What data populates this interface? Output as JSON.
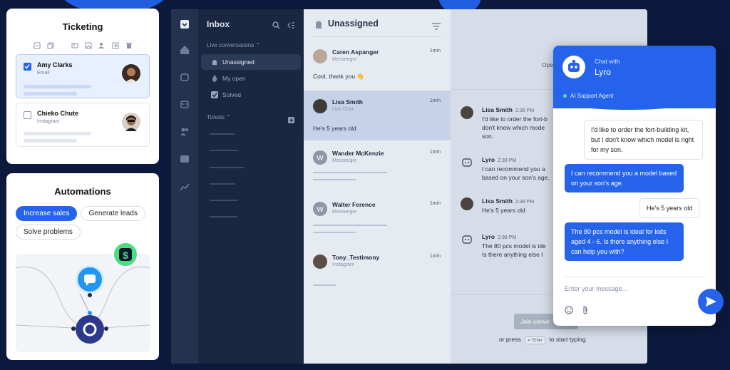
{
  "colors": {
    "background": "#0b1a3c",
    "accent": "#2563eb",
    "sidebar": "#1a2740"
  },
  "ticketing": {
    "title": "Ticketing",
    "toolbar_icons": [
      "collapse-icon",
      "copy-icon",
      "image-icon",
      "image-alt-icon",
      "assign-user-icon",
      "export-icon",
      "trash-icon"
    ],
    "tickets": [
      {
        "name": "Amy Clarks",
        "source": "Email",
        "checked": true
      },
      {
        "name": "Chieko Chute",
        "source": "Instagram",
        "checked": false
      }
    ]
  },
  "automations": {
    "title": "Automations",
    "pills": [
      "Increase sales",
      "Generate leads",
      "Solve problems"
    ],
    "active_pill": "Increase sales",
    "badge_icon": "dollar-icon"
  },
  "inbox": {
    "title": "Inbox",
    "live_label": "Live conversations",
    "items": [
      {
        "label": "Unassigned",
        "icon": "hand-wave-icon",
        "active": true
      },
      {
        "label": "My open",
        "icon": "fire-icon",
        "active": false
      },
      {
        "label": "Solved",
        "icon": "check-icon",
        "active": false
      }
    ],
    "tickets_label": "Tickets"
  },
  "conversations": {
    "title": "Unassigned",
    "list": [
      {
        "name": "Caren Aspanger",
        "source": "Messenger",
        "time": "1min",
        "message": "Cool, thank you 👋"
      },
      {
        "name": "Lisa Smith",
        "source": "Live Chat",
        "time": "1min",
        "message": "He's 5 years old",
        "active": true
      },
      {
        "name": "Wander McKenzie",
        "source": "Messenger",
        "time": "1min",
        "message": ""
      },
      {
        "name": "Walter Ference",
        "source": "Messenger",
        "time": "1min",
        "message": ""
      },
      {
        "name": "Tony_Testimony",
        "source": "Instagram",
        "time": "1min",
        "message": ""
      }
    ]
  },
  "chat": {
    "header_partial": "Ope",
    "messages": [
      {
        "name": "Lisa Smith",
        "time": "2:38 PM",
        "text": "I'd like to order the fort-b\ndon't know which mode\nson."
      },
      {
        "name": "Lyro",
        "time": "2:38 PM",
        "text": "I can recommend you a\nbased on your son's age."
      },
      {
        "name": "Lisa Smith",
        "time": "2:38 PM",
        "text": "He's 5 years old"
      },
      {
        "name": "Lyro",
        "time": "2:38 PM",
        "text": "The 80 pcs model is ide\nIs there anything else I"
      }
    ],
    "join_button": "Join conve",
    "press_prefix": "or press",
    "press_key": "↵ Enter",
    "press_suffix": "to start typing"
  },
  "lyro": {
    "chat_with": "Chat with",
    "name": "Lyro",
    "agent_label": "AI Support Agent",
    "messages": [
      {
        "from": "user",
        "text": "I'd like to order the fort-building kit, but I don't know which model is right for my son."
      },
      {
        "from": "bot",
        "text": "I can recommend you a model based on your son's age."
      },
      {
        "from": "user",
        "text": "He's 5 years old"
      },
      {
        "from": "bot",
        "text": "The 80 pcs model is ideal for kids aged 4 - 6. Is there anything else I can help you with?"
      }
    ],
    "input_placeholder": "Enter your message...",
    "tool_icons": [
      "emoji-icon",
      "attachment-icon"
    ],
    "send_icon": "send-icon"
  }
}
